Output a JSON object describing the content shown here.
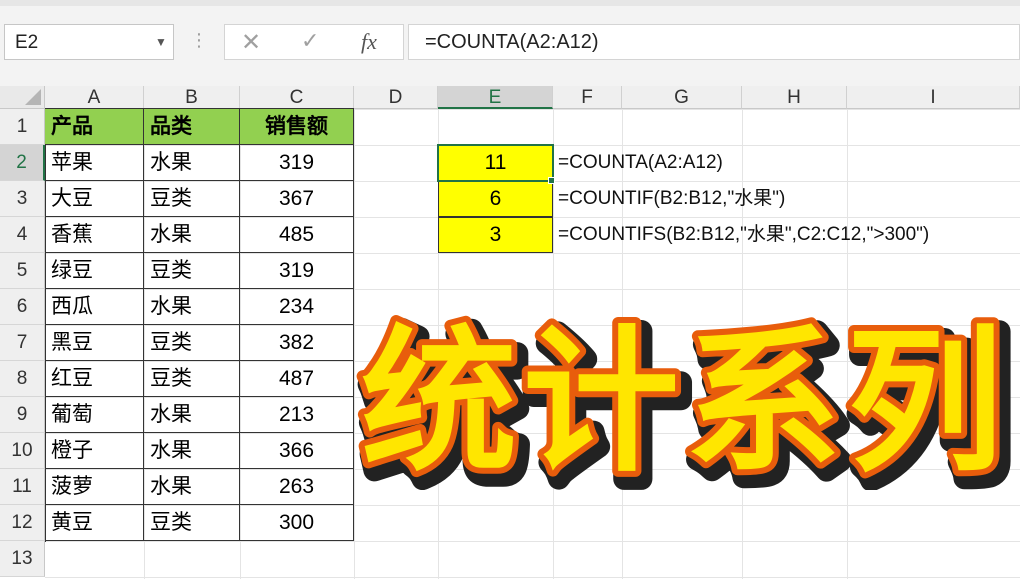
{
  "formula_bar": {
    "name_box": "E2",
    "formula": "=COUNTA(A2:A12)",
    "fx_label": "fx",
    "cancel_glyph": "✕",
    "enter_glyph": "✓",
    "dots": "⋮"
  },
  "columns": [
    "A",
    "B",
    "C",
    "D",
    "E",
    "F",
    "G",
    "H",
    "I"
  ],
  "rows": [
    "1",
    "2",
    "3",
    "4",
    "5",
    "6",
    "7",
    "8",
    "9",
    "10",
    "11",
    "12",
    "13"
  ],
  "table": {
    "headers": [
      "产品",
      "品类",
      "销售额"
    ],
    "rows": [
      [
        "苹果",
        "水果",
        "319"
      ],
      [
        "大豆",
        "豆类",
        "367"
      ],
      [
        "香蕉",
        "水果",
        "485"
      ],
      [
        "绿豆",
        "豆类",
        "319"
      ],
      [
        "西瓜",
        "水果",
        "234"
      ],
      [
        "黑豆",
        "豆类",
        "382"
      ],
      [
        "红豆",
        "豆类",
        "487"
      ],
      [
        "葡萄",
        "水果",
        "213"
      ],
      [
        "橙子",
        "水果",
        "366"
      ],
      [
        "菠萝",
        "水果",
        "263"
      ],
      [
        "黄豆",
        "豆类",
        "300"
      ]
    ]
  },
  "results": [
    {
      "value": "11",
      "formula": "=COUNTA(A2:A12)"
    },
    {
      "value": "6",
      "formula": "=COUNTIF(B2:B12,\"水果\")"
    },
    {
      "value": "3",
      "formula": "=COUNTIFS(B2:B12,\"水果\",C2:C12,\">300\")"
    }
  ],
  "overlay_title": "统计系列",
  "colors": {
    "header_fill": "#92d050",
    "result_fill": "#ffff00",
    "excel_green": "#217346",
    "title_fill": "#ffe600",
    "title_outline": "#e85d0c",
    "title_shadow": "#222222"
  }
}
